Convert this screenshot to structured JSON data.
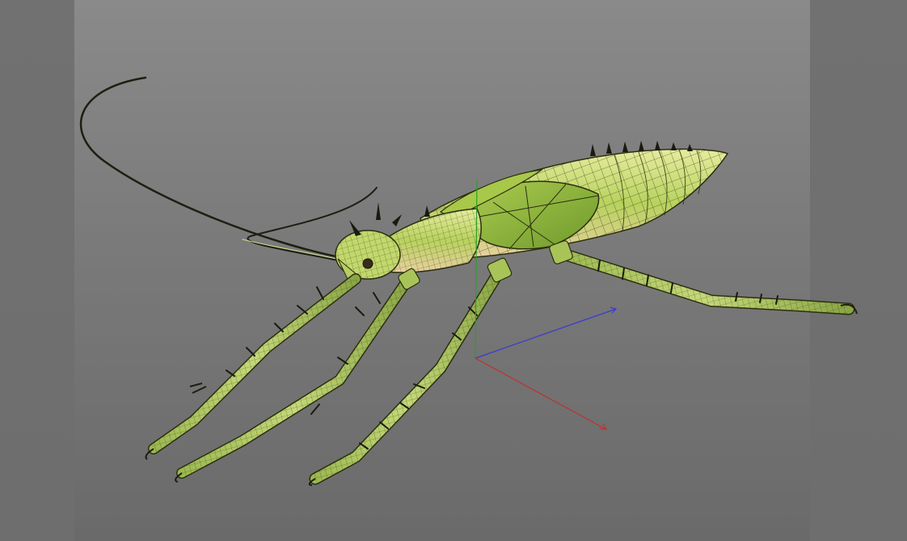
{
  "viewport": {
    "background_top": "#8a8a8a",
    "background_bottom": "#6a6a6a",
    "margin_color": "#6f6f6f"
  },
  "model": {
    "body_color": "#b4cf5c",
    "body_highlight": "#e2ea9a",
    "wing_color": "#8fb43c",
    "belly_color": "#f0d8b0",
    "wire_color": "#2b2e10",
    "spine_color": "#1a1a10"
  },
  "gizmo": {
    "x_axis_color": "#c03030",
    "y_axis_color": "#28a028",
    "z_axis_color": "#3a3ad0"
  }
}
